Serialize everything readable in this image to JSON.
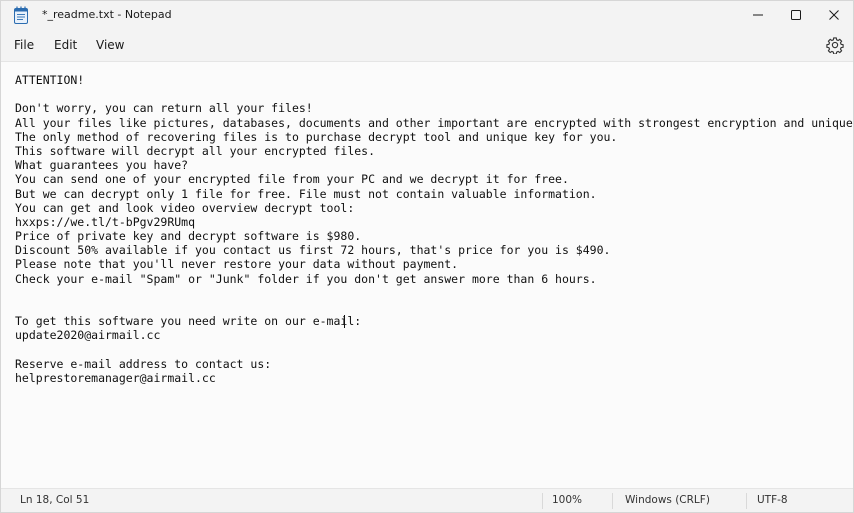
{
  "window": {
    "title": "*_readme.txt - Notepad"
  },
  "icons": {
    "app": "notepad-icon",
    "minimize": "minimize-icon",
    "maximize": "maximize-icon",
    "close": "close-icon",
    "settings": "gear-icon"
  },
  "menu": {
    "items": [
      "File",
      "Edit",
      "View"
    ]
  },
  "editor": {
    "lines": [
      "ATTENTION!",
      "",
      "Don't worry, you can return all your files!",
      "All your files like pictures, databases, documents and other important are encrypted with strongest encryption and unique key.",
      "The only method of recovering files is to purchase decrypt tool and unique key for you.",
      "This software will decrypt all your encrypted files.",
      "What guarantees you have?",
      "You can send one of your encrypted file from your PC and we decrypt it for free.",
      "But we can decrypt only 1 file for free. File must not contain valuable information.",
      "You can get and look video overview decrypt tool:",
      "hxxps://we.tl/t-bPgv29RUmq",
      "Price of private key and decrypt software is $980.",
      "Discount 50% available if you contact us first 72 hours, that's price for you is $490.",
      "Please note that you'll never restore your data without payment.",
      "Check your e-mail \"Spam\" or \"Junk\" folder if you don't get answer more than 6 hours.",
      "",
      "",
      "To get this software you need write on our e-mail:",
      "update2020@airmail.cc",
      "",
      "Reserve e-mail address to contact us:",
      "helprestoremanager@airmail.cc"
    ]
  },
  "status": {
    "position": "Ln 18, Col 51",
    "zoom": "100%",
    "line_ending": "Windows (CRLF)",
    "encoding": "UTF-8"
  }
}
